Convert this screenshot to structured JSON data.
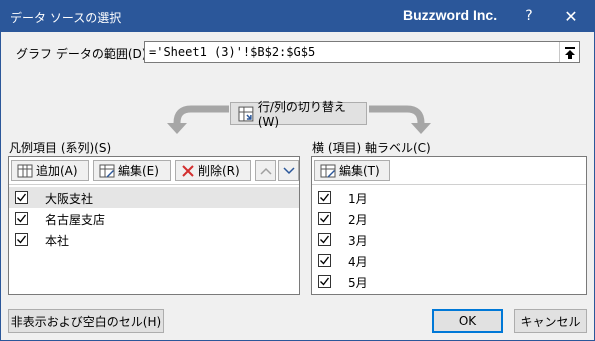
{
  "window": {
    "title": "データ ソースの選択",
    "app_name": "Buzzword Inc.",
    "help_label": "?",
    "close_label": "✕"
  },
  "range": {
    "label": "グラフ データの範囲(D):",
    "value": "='Sheet1 (3)'!$B$2:$G$5"
  },
  "switch_button": {
    "label": "行/列の切り替え(W)"
  },
  "legend": {
    "label": "凡例項目 (系列)(S)",
    "add_label": "追加(A)",
    "edit_label": "編集(E)",
    "delete_label": "削除(R)",
    "items": [
      {
        "label": "大阪支社",
        "checked": true,
        "selected": true
      },
      {
        "label": "名古屋支店",
        "checked": true,
        "selected": false
      },
      {
        "label": "本社",
        "checked": true,
        "selected": false
      }
    ]
  },
  "axis": {
    "label": "横 (項目) 軸ラベル(C)",
    "edit_label": "編集(T)",
    "items": [
      {
        "label": "1月",
        "checked": true
      },
      {
        "label": "2月",
        "checked": true
      },
      {
        "label": "3月",
        "checked": true
      },
      {
        "label": "4月",
        "checked": true
      },
      {
        "label": "5月",
        "checked": true
      }
    ]
  },
  "footer": {
    "hidden_cells_label": "非表示および空白のセル(H)",
    "ok_label": "OK",
    "cancel_label": "キャンセル"
  },
  "colors": {
    "titlebar": "#2b579a",
    "selected_row": "#e5e5e5",
    "delete_icon": "#d32f2f",
    "default_button_border": "#0078d7"
  }
}
